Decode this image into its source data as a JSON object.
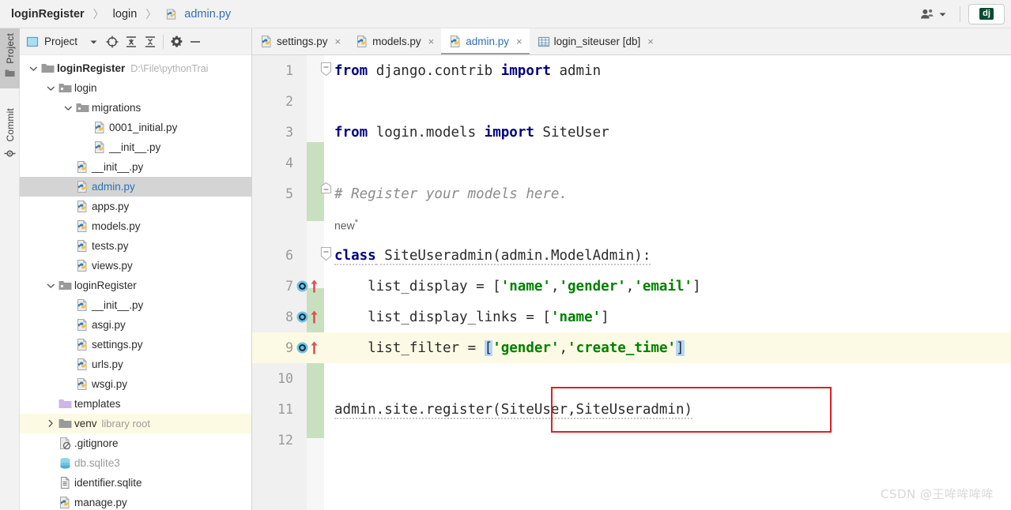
{
  "breadcrumb": {
    "items": [
      {
        "label": "loginRegister",
        "style": "bold",
        "icon": ""
      },
      {
        "label": "login",
        "style": "plain",
        "icon": ""
      },
      {
        "label": "admin.py",
        "style": "link",
        "icon": "python-file-icon"
      }
    ],
    "separator": "〉"
  },
  "topbar_right": {
    "user_icon": "user-account-icon",
    "dropdown_icon": "chevron-down-icon",
    "run_config_badge": "dj"
  },
  "tool_strip": {
    "tabs": [
      {
        "label": "Project",
        "icon": "folder-icon",
        "active": true
      },
      {
        "label": "Commit",
        "icon": "commit-icon",
        "active": false
      }
    ]
  },
  "project_panel": {
    "title": "Project",
    "toolbar_icons": [
      "chevron-down-icon",
      "locate-target-icon",
      "expand-all-icon",
      "collapse-all-icon",
      "gear-icon",
      "minimize-icon"
    ],
    "tree": [
      {
        "label": "loginRegister",
        "sub": "D:\\File\\pythonTrai",
        "icon": "folder-icon",
        "indent": 0,
        "twisty": "expanded",
        "style": "bold",
        "state": "normal"
      },
      {
        "label": "login",
        "sub": "",
        "icon": "module-folder-icon",
        "indent": 1,
        "twisty": "expanded",
        "style": "plain",
        "state": "normal"
      },
      {
        "label": "migrations",
        "sub": "",
        "icon": "module-folder-icon",
        "indent": 2,
        "twisty": "expanded",
        "style": "plain",
        "state": "normal"
      },
      {
        "label": "0001_initial.py",
        "sub": "",
        "icon": "python-file-icon",
        "indent": 3,
        "twisty": "none",
        "style": "plain",
        "state": "normal"
      },
      {
        "label": "__init__.py",
        "sub": "",
        "icon": "python-file-icon",
        "indent": 3,
        "twisty": "none",
        "style": "plain",
        "state": "normal"
      },
      {
        "label": "__init__.py",
        "sub": "",
        "icon": "python-file-icon",
        "indent": 2,
        "twisty": "none",
        "style": "plain",
        "state": "normal"
      },
      {
        "label": "admin.py",
        "sub": "",
        "icon": "python-file-icon",
        "indent": 2,
        "twisty": "none",
        "style": "blue",
        "state": "selected"
      },
      {
        "label": "apps.py",
        "sub": "",
        "icon": "python-file-icon",
        "indent": 2,
        "twisty": "none",
        "style": "plain",
        "state": "normal"
      },
      {
        "label": "models.py",
        "sub": "",
        "icon": "python-file-icon",
        "indent": 2,
        "twisty": "none",
        "style": "plain",
        "state": "normal"
      },
      {
        "label": "tests.py",
        "sub": "",
        "icon": "python-file-icon",
        "indent": 2,
        "twisty": "none",
        "style": "plain",
        "state": "normal"
      },
      {
        "label": "views.py",
        "sub": "",
        "icon": "python-file-icon",
        "indent": 2,
        "twisty": "none",
        "style": "plain",
        "state": "normal"
      },
      {
        "label": "loginRegister",
        "sub": "",
        "icon": "module-folder-icon",
        "indent": 1,
        "twisty": "expanded",
        "style": "plain",
        "state": "normal"
      },
      {
        "label": "__init__.py",
        "sub": "",
        "icon": "python-file-icon",
        "indent": 2,
        "twisty": "none",
        "style": "plain",
        "state": "normal"
      },
      {
        "label": "asgi.py",
        "sub": "",
        "icon": "python-file-icon",
        "indent": 2,
        "twisty": "none",
        "style": "plain",
        "state": "normal"
      },
      {
        "label": "settings.py",
        "sub": "",
        "icon": "python-file-icon",
        "indent": 2,
        "twisty": "none",
        "style": "plain",
        "state": "normal"
      },
      {
        "label": "urls.py",
        "sub": "",
        "icon": "python-file-icon",
        "indent": 2,
        "twisty": "none",
        "style": "plain",
        "state": "normal"
      },
      {
        "label": "wsgi.py",
        "sub": "",
        "icon": "python-file-icon",
        "indent": 2,
        "twisty": "none",
        "style": "plain",
        "state": "normal"
      },
      {
        "label": "templates",
        "sub": "",
        "icon": "templates-folder-icon",
        "indent": 1,
        "twisty": "none",
        "style": "plain",
        "state": "normal"
      },
      {
        "label": "venv",
        "sub2": "library root",
        "icon": "folder-icon",
        "indent": 1,
        "twisty": "collapsed",
        "style": "plain",
        "state": "highlighted"
      },
      {
        "label": ".gitignore",
        "sub": "",
        "icon": "gitignore-file-icon",
        "indent": 1,
        "twisty": "none",
        "style": "plain",
        "state": "normal"
      },
      {
        "label": "db.sqlite3",
        "sub": "",
        "icon": "database-file-icon",
        "indent": 1,
        "twisty": "none",
        "style": "grey",
        "state": "normal"
      },
      {
        "label": "identifier.sqlite",
        "sub": "",
        "icon": "generic-file-icon",
        "indent": 1,
        "twisty": "none",
        "style": "plain",
        "state": "normal"
      },
      {
        "label": "manage.py",
        "sub": "",
        "icon": "python-file-icon",
        "indent": 1,
        "twisty": "none",
        "style": "plain",
        "state": "normal"
      }
    ]
  },
  "editor": {
    "tabs": [
      {
        "label": "settings.py",
        "icon": "python-file-icon",
        "active": false,
        "close": "×"
      },
      {
        "label": "models.py",
        "icon": "python-file-icon",
        "active": false,
        "close": "×"
      },
      {
        "label": "admin.py",
        "icon": "python-file-icon",
        "active": true,
        "close": "×"
      },
      {
        "label": "login_siteuser [db]",
        "icon": "table-icon",
        "active": false,
        "close": "×"
      }
    ],
    "line_numbers": [
      "1",
      "2",
      "3",
      "4",
      "5",
      "6",
      "7",
      "8",
      "9",
      "10",
      "11",
      "12"
    ],
    "code_lines": [
      {
        "num": "1",
        "text": "from django.contrib import admin"
      },
      {
        "num": "2",
        "text": ""
      },
      {
        "num": "3",
        "text": "from login.models import SiteUser"
      },
      {
        "num": "4",
        "text": ""
      },
      {
        "num": "5",
        "text": "# Register your models here."
      },
      {
        "num": "6",
        "text": "class SiteUseradmin(admin.ModelAdmin):"
      },
      {
        "num": "7",
        "text": "    list_display = ['name','gender','email']"
      },
      {
        "num": "8",
        "text": "    list_display_links = ['name']"
      },
      {
        "num": "9",
        "text": "    list_filter = ['gender','create_time']"
      },
      {
        "num": "10",
        "text": ""
      },
      {
        "num": "11",
        "text": "admin.site.register(SiteUser,SiteUseradmin)"
      },
      {
        "num": "12",
        "text": ""
      }
    ],
    "inlay_hint": "new",
    "inlay_hint_star": "*",
    "current_line": "9",
    "gutter_markers": [
      {
        "line": "7",
        "icon": "property-marker-icon"
      },
      {
        "line": "8",
        "icon": "property-marker-icon"
      },
      {
        "line": "9",
        "icon": "property-marker-icon"
      }
    ],
    "annotation_box": {
      "target_line": "11",
      "color": "#e02020"
    }
  },
  "watermark": "CSDN @王哞哞哞哞",
  "colors": {
    "keyword": "#000080",
    "string": "#008000",
    "comment": "#8c8c8c",
    "link": "#2f6fb5",
    "selection": "#d4d4d4",
    "current_line": "#fcfae4",
    "change_marker": "#c9e0c0",
    "annotation": "#e02020",
    "django_badge": "#0c4b33"
  }
}
